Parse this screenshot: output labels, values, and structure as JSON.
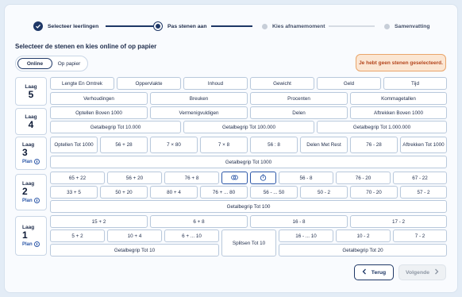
{
  "stepper": {
    "steps": [
      {
        "label": "Selecteer leerlingen",
        "state": "done"
      },
      {
        "label": "Pas stenen aan",
        "state": "active"
      },
      {
        "label": "Kies afnamemoment",
        "state": "todo"
      },
      {
        "label": "Samenvatting",
        "state": "todo"
      }
    ]
  },
  "heading": "Selecteer de stenen en kies online of op papier",
  "mode": {
    "online": "Online",
    "paper": "Op papier",
    "selected": "Online"
  },
  "warning": "Je hebt geen stenen geselecteerd.",
  "laag": {
    "word": "Laag",
    "plan": "Plan",
    "l5": "5",
    "l4": "4",
    "l3": "3",
    "l2": "2",
    "l1": "1"
  },
  "tiles": {
    "l5r1": [
      "Lengte En Omtrek",
      "Oppervlakte",
      "Inhoud",
      "Gewicht",
      "Geld",
      "Tijd"
    ],
    "l5r2": [
      "Verhoudingen",
      "Breuken",
      "Procenten",
      "Kommagetallen"
    ],
    "l4r1": [
      "Optellen Boven 1000",
      "Vermenigvuldigen",
      "Delen",
      "Aftrekken Boven 1000"
    ],
    "l4r2": [
      "Getalbegrip Tot 10.000",
      "Getalbegrip Tot 100.000",
      "Getalbegrip Tot 1.000.000"
    ],
    "l3r1": [
      "Optellen Tot 1000",
      "56 + 28",
      "7 × 80",
      "7 × 8",
      "56 : 8",
      "Delen Met Rest",
      "76 - 28",
      "Aftrekken Tot 1000"
    ],
    "l3r2": [
      "Getalbegrip Tot 1000"
    ],
    "l2r1": [
      "65 + 22",
      "56 + 20",
      "76 + 8",
      "56 - 8",
      "76 - 20",
      "67 - 22"
    ],
    "l2r2": [
      "33 + 5",
      "50 + 20",
      "80 + 4",
      "76 + ... 80",
      "56 - ... 50",
      "50 - 2",
      "70 - 20",
      "57 - 2"
    ],
    "l2r3": [
      "Getalbegrip Tot 100"
    ],
    "l1r1": [
      "15 + 2",
      "6 + 8",
      "16 - 8",
      "17 - 2"
    ],
    "l1r2": [
      "5 + 2",
      "10 + 4",
      "6 + ... 10",
      "Splitsen Tot 10",
      "16 - ... 10",
      "10 - 2",
      "7 - 2"
    ],
    "l1r3": [
      "Getalbegrip Tot 10",
      "Getalbegrip Tot 20"
    ]
  },
  "nav": {
    "back": "Terug",
    "next": "Volgende"
  },
  "icons": {
    "check": "check-icon",
    "split": "split-icon",
    "timer": "timer-icon",
    "chevron_left": "chevron-left-icon",
    "chevron_right": "chevron-right-icon"
  },
  "colors": {
    "accent": "#1e3766",
    "link": "#2c57a8",
    "warning_bg": "#fbe6d3",
    "warning_text": "#b4461e"
  }
}
